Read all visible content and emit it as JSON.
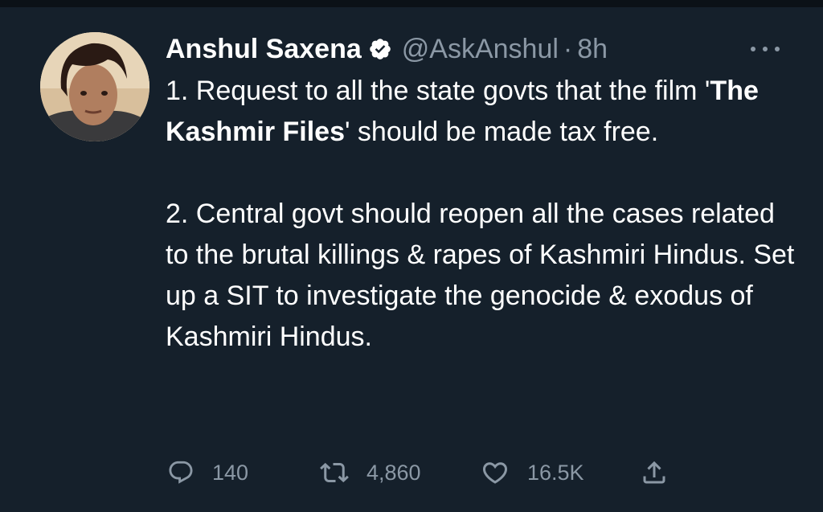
{
  "author": {
    "display_name": "Anshul Saxena",
    "handle": "@AskAnshul",
    "separator": "·",
    "time": "8h",
    "verified": true,
    "avatar_icon": "profile-photo"
  },
  "tweet": {
    "p1_before": "1. Request to all the state govts that the film '",
    "p1_bold": "The Kashmir Files",
    "p1_after": "' should be made tax free.",
    "p2": "2. Central govt should reopen all the cases related to the brutal killings & rapes of Kashmiri Hindus. Set up a SIT to investigate the genocide & exodus of Kashmiri Hindus."
  },
  "actions": {
    "reply": {
      "icon": "reply-icon",
      "count": "140"
    },
    "retweet": {
      "icon": "retweet-icon",
      "count": "4,860"
    },
    "like": {
      "icon": "heart-icon",
      "count": "16.5K"
    },
    "share": {
      "icon": "share-icon"
    }
  },
  "colors": {
    "background": "#15202b",
    "text": "#ffffff",
    "secondary": "#8b98a5"
  }
}
